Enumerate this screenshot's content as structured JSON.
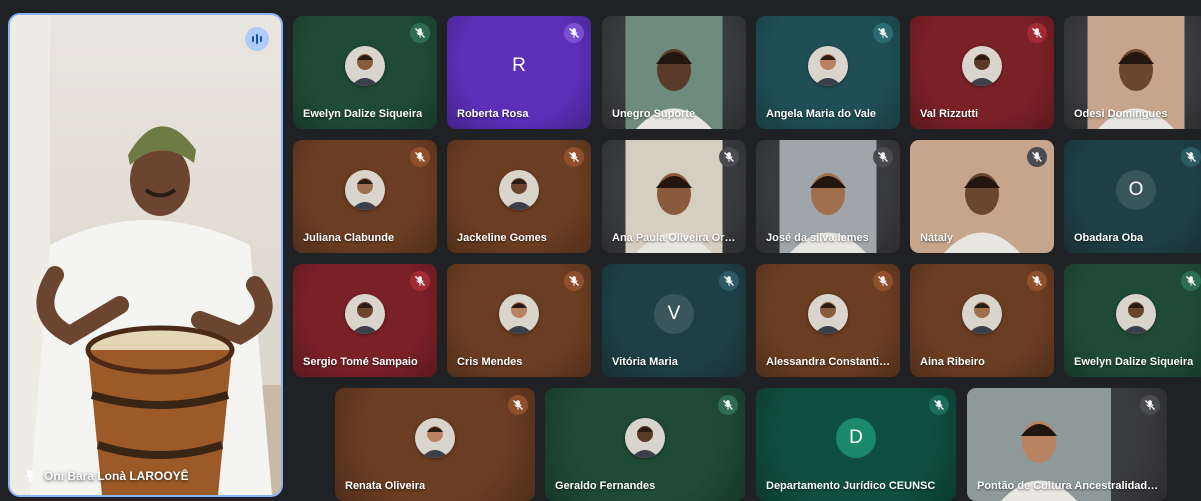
{
  "speaker": {
    "name": "Oni Bara Lonà LAROOYÊ",
    "pin_icon": "pin-icon",
    "speaking_icon": "audio-levels-icon"
  },
  "tiles": [
    {
      "name": "Ewelyn Dalize Siqueira",
      "type": "avatar",
      "bg": "#1f4a36",
      "mic": "#2e6d50"
    },
    {
      "name": "Roberta Rosa",
      "type": "initial",
      "initial": "R",
      "bg": "#5b2fb8",
      "mic": "#7a4fd0"
    },
    {
      "name": "Unegro Suporte",
      "type": "video",
      "bg": "#3a3b3e",
      "mic": ""
    },
    {
      "name": "Angela Maria do Vale",
      "type": "avatar",
      "bg": "#1f4f55",
      "mic": "#2b6b72"
    },
    {
      "name": "Val Rizzutti",
      "type": "avatar",
      "bg": "#7a2027",
      "mic": "#a22b33"
    },
    {
      "name": "Odesi Domingues",
      "type": "video",
      "bg": "#3a3b3e",
      "mic": ""
    },
    {
      "name": "Juliana Clabunde",
      "type": "avatar",
      "bg": "#6b3d22",
      "mic": "#8f4f2b"
    },
    {
      "name": "Jackeline Gomes",
      "type": "avatar",
      "bg": "#6b3d22",
      "mic": "#8f4f2b"
    },
    {
      "name": "Ana Paula Oliveira Orù...",
      "type": "video",
      "bg": "#3a3b3e",
      "mic": "#4a4b4f"
    },
    {
      "name": "José da silva lemes",
      "type": "video",
      "bg": "#3a3b3e",
      "mic": "#4a4b4f"
    },
    {
      "name": "Nátaly",
      "type": "video",
      "bg": "#3a3b3e",
      "mic": "#4a4b4f"
    },
    {
      "name": "Obadara Oba",
      "type": "initial",
      "initial": "O",
      "bg": "#1e3f46",
      "mic": "#2b5a63"
    },
    {
      "name": "Sergio Tomé Sampaio",
      "type": "avatar",
      "bg": "#7a2027",
      "mic": "#a22b33"
    },
    {
      "name": "Cris Mendes",
      "type": "avatar",
      "bg": "#6b3d22",
      "mic": "#8f4f2b"
    },
    {
      "name": "Vitória Maria",
      "type": "initial",
      "initial": "V",
      "bg": "#1e3f46",
      "mic": "#2b5a63"
    },
    {
      "name": "Alessandra Constantino",
      "type": "avatar",
      "bg": "#6b3d22",
      "mic": "#8f4f2b"
    },
    {
      "name": "Aina Ribeiro",
      "type": "avatar",
      "bg": "#6b3d22",
      "mic": "#8f4f2b"
    },
    {
      "name": "Ewelyn Dalize Siqueira",
      "type": "avatar",
      "bg": "#1f4a36",
      "mic": "#2e6d50"
    },
    {
      "name": "Renata Oliveira",
      "type": "avatar",
      "bg": "#6b3d22",
      "mic": "#8f4f2b"
    },
    {
      "name": "Geraldo Fernandes",
      "type": "avatar",
      "bg": "#1f4a36",
      "mic": "#2e6d50"
    },
    {
      "name": "Departamento Jurídico CEUNSC",
      "type": "initial",
      "initial": "D",
      "bg": "#0f4f3f",
      "mic": "#1a6b57"
    },
    {
      "name": "Pontão de Cultura Ancestralidade...",
      "type": "video",
      "bg": "#3a3b3e",
      "mic": "#4a4b4f"
    }
  ]
}
